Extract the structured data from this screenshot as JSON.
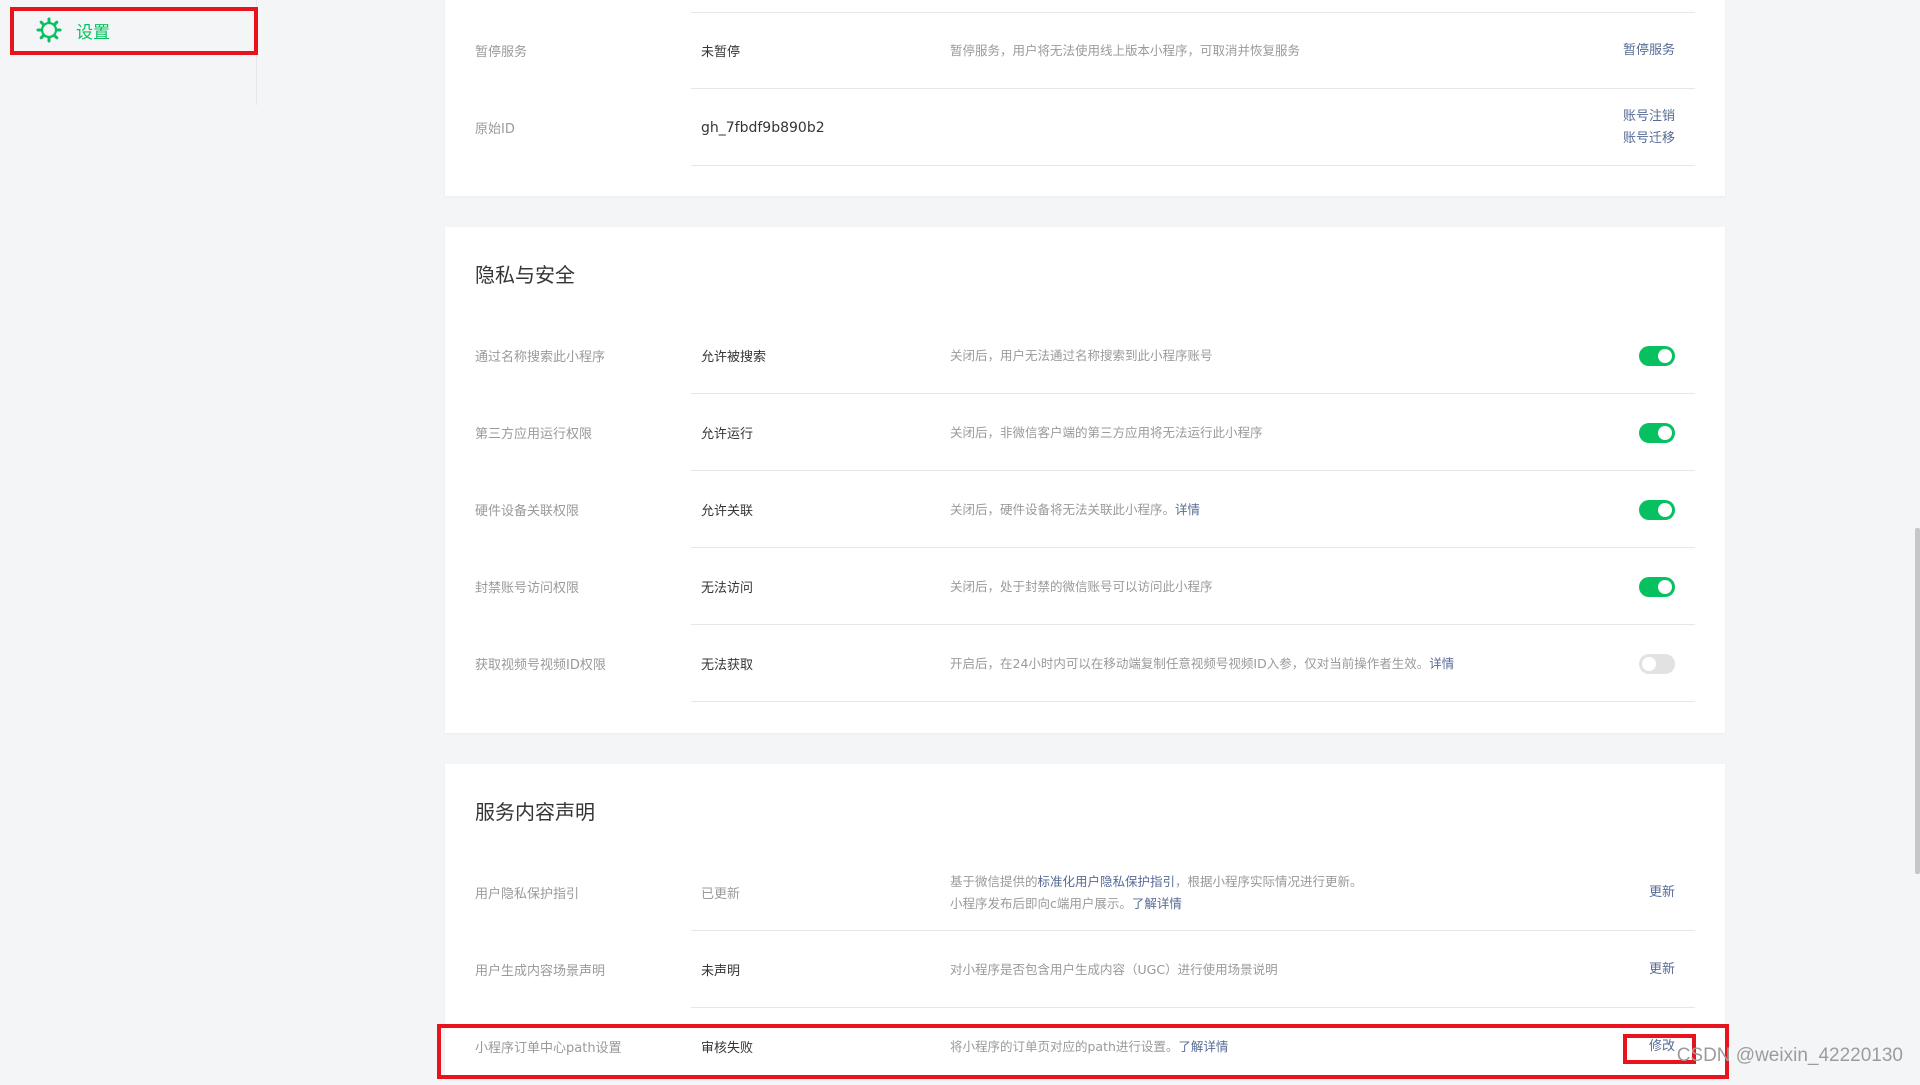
{
  "sidebar": {
    "items": [
      {
        "label": "设置",
        "icon": "gear-icon",
        "active": true
      }
    ]
  },
  "colors": {
    "accent": "#07c160",
    "link": "#576b95",
    "annotation": "#e8131d"
  },
  "basic": {
    "rows": [
      {
        "label": "暂停服务",
        "value": "未暂停",
        "desc": "暂停服务，用户将无法使用线上版本小程序，可取消并恢复服务",
        "actions": [
          "暂停服务"
        ]
      },
      {
        "label": "原始ID",
        "value": "gh_7fbdf9b890b2",
        "desc": "",
        "actions": [
          "账号注销",
          "账号迁移"
        ]
      }
    ]
  },
  "privacy": {
    "title": "隐私与安全",
    "rows": [
      {
        "label": "通过名称搜索此小程序",
        "value": "允许被搜索",
        "desc": "关闭后，用户无法通过名称搜索到此小程序账号",
        "link": "",
        "toggle": true
      },
      {
        "label": "第三方应用运行权限",
        "value": "允许运行",
        "desc": "关闭后，非微信客户端的第三方应用将无法运行此小程序",
        "link": "",
        "toggle": true
      },
      {
        "label": "硬件设备关联权限",
        "value": "允许关联",
        "desc": "关闭后，硬件设备将无法关联此小程序。",
        "link": "详情",
        "toggle": true
      },
      {
        "label": "封禁账号访问权限",
        "value": "无法访问",
        "desc": "关闭后，处于封禁的微信账号可以访问此小程序",
        "link": "",
        "toggle": true
      },
      {
        "label": "获取视频号视频ID权限",
        "value": "无法获取",
        "desc": "开启后，在24小时内可以在移动端复制任意视频号视频ID入参，仅对当前操作者生效。",
        "link": "详情",
        "toggle": false
      }
    ]
  },
  "service": {
    "title": "服务内容声明",
    "rows": [
      {
        "label": "用户隐私保护指引",
        "value": "已更新",
        "desc_pre": "基于微信提供的",
        "desc_link": "标准化用户隐私保护指引",
        "desc_post": "，根据小程序实际情况进行更新。",
        "desc_line2": "小程序发布后即向c端用户展示。",
        "desc_line2_link": "了解详情",
        "action": "更新"
      },
      {
        "label": "用户生成内容场景声明",
        "value": "未声明",
        "desc": "对小程序是否包含用户生成内容（UGC）进行使用场景说明",
        "action": "更新"
      },
      {
        "label": "小程序订单中心path设置",
        "value": "审核失败",
        "desc": "将小程序的订单页对应的path进行设置。",
        "link": "了解详情",
        "action": "修改"
      }
    ]
  },
  "watermark": "CSDN @weixin_42220130"
}
